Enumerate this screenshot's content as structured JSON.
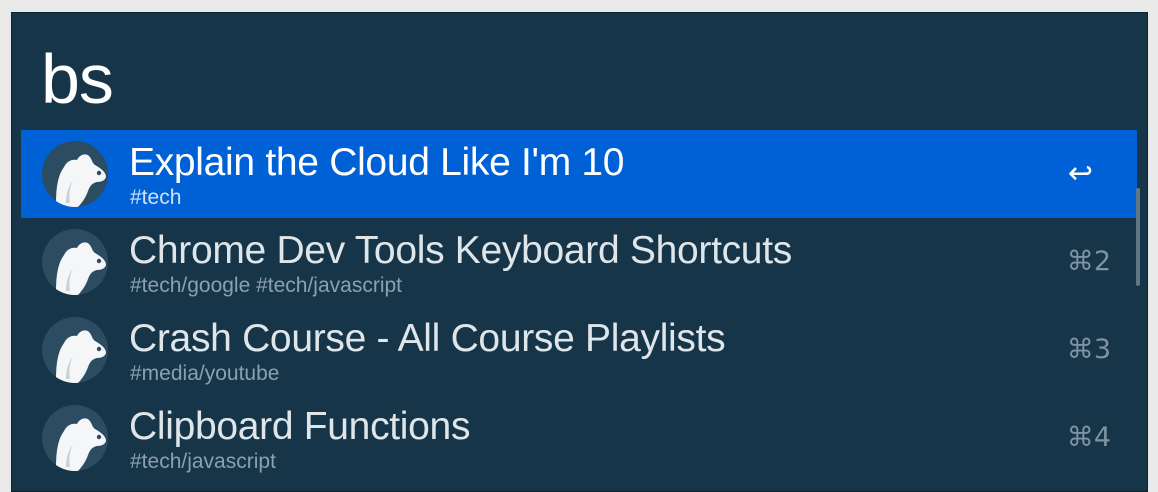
{
  "search": {
    "query": "bs"
  },
  "results": [
    {
      "title": "Explain the Cloud Like I'm 10",
      "tags": "#tech",
      "shortcut": "↩",
      "selected": true,
      "icon": "bear-icon"
    },
    {
      "title": "Chrome Dev Tools Keyboard Shortcuts",
      "tags": "#tech/google #tech/javascript",
      "shortcut": "⌘2",
      "selected": false,
      "icon": "bear-icon"
    },
    {
      "title": "Crash Course - All Course Playlists",
      "tags": "#media/youtube",
      "shortcut": "⌘3",
      "selected": false,
      "icon": "bear-icon"
    },
    {
      "title": "Clipboard Functions",
      "tags": "#tech/javascript",
      "shortcut": "⌘4",
      "selected": false,
      "icon": "bear-icon"
    }
  ],
  "colors": {
    "background": "#173549",
    "selected_row": "#0061d6",
    "text": "#ffffff",
    "muted": "#8aa0ae"
  }
}
